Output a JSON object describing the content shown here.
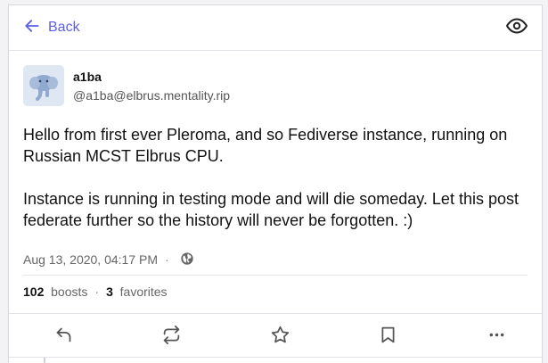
{
  "header": {
    "back_label": "Back"
  },
  "status": {
    "display_name": "a1ba",
    "acct": "@a1ba@elbrus.mentality.rip",
    "content": [
      "Hello from first ever Pleroma, and so Fediverse instance, running on Russian MCST Elbrus CPU.",
      "Instance is running in testing mode and will die someday. Let this post federate further so the history will never be forgotten. :)"
    ],
    "timestamp": "Aug 13, 2020, 04:17 PM",
    "separator": "·",
    "visibility_icon": "globe-icon",
    "boosts_count": "102",
    "boosts_label": "boosts",
    "favorites_count": "3",
    "favorites_label": "favorites"
  },
  "icons": {
    "back": "arrow-left-icon",
    "view": "eye-icon",
    "reply": "reply-icon",
    "boost": "repeat-icon",
    "favorite": "star-icon",
    "bookmark": "bookmark-icon",
    "more": "more-horizontal-icon"
  },
  "colors": {
    "accent": "#5b5fe0",
    "text": "#111111",
    "muted": "#666666",
    "border": "#e2e2e8"
  }
}
